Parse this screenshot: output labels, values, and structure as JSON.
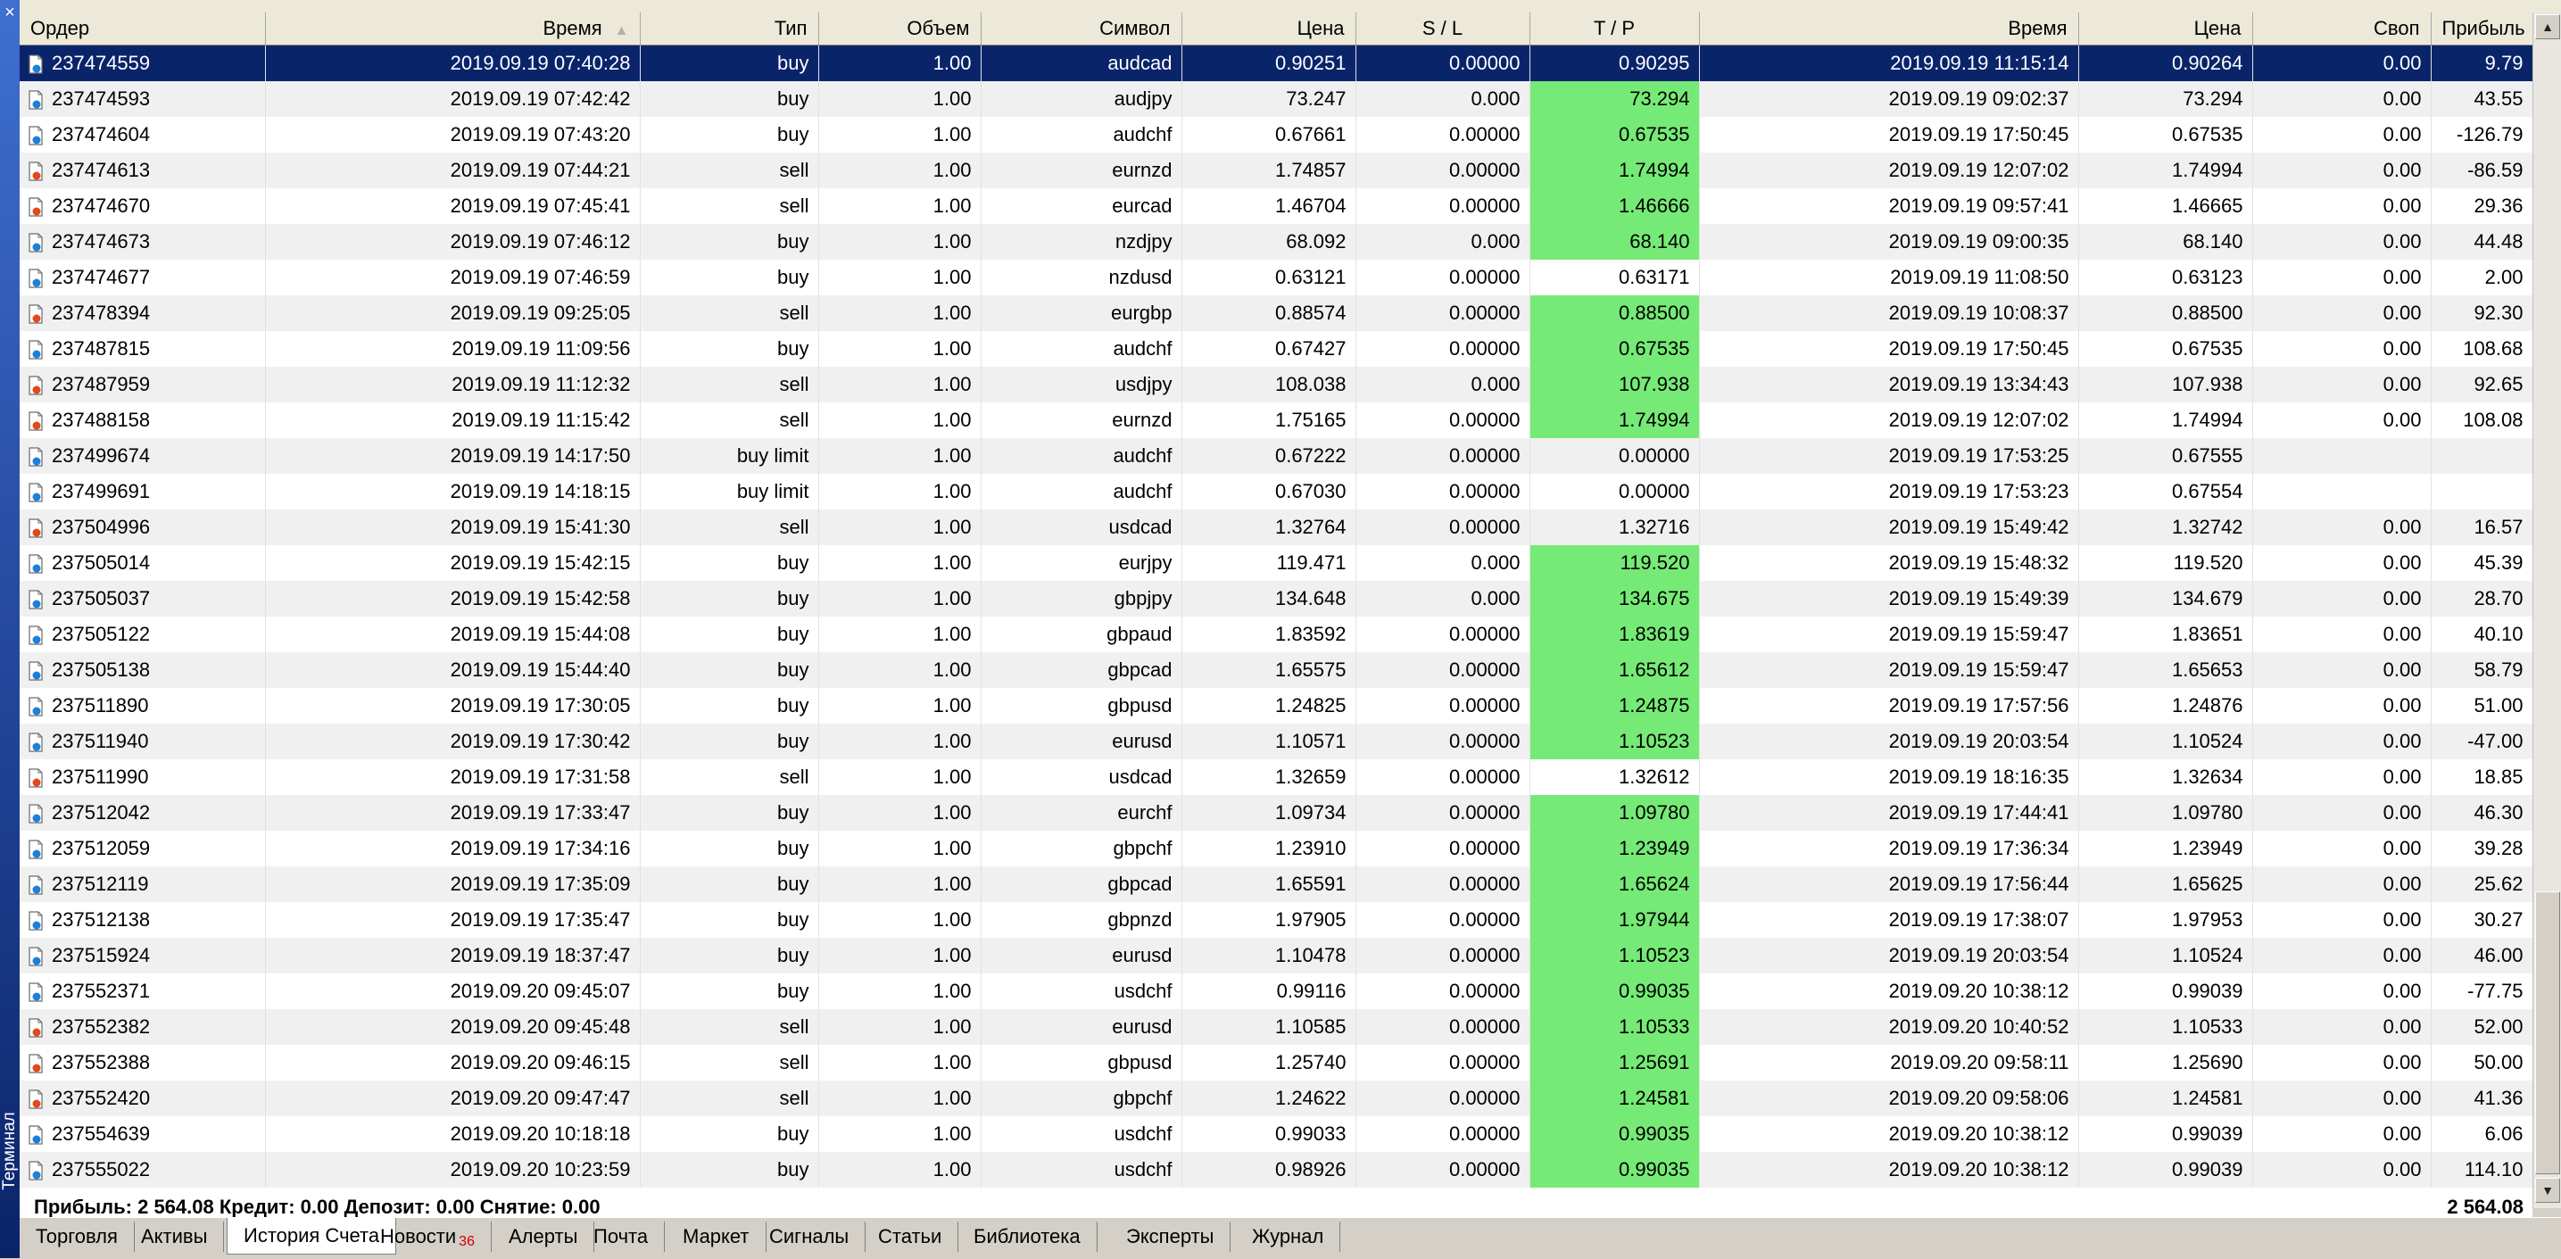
{
  "window": {
    "side_title": "Терминал",
    "close_label": "×"
  },
  "columns": [
    "Ордер",
    "Время",
    "Тип",
    "Объем",
    "Символ",
    "Цена",
    "S / L",
    "T / P",
    "Время",
    "Цена",
    "Своп",
    "Прибыль"
  ],
  "sort_indicator": "▲",
  "rows": [
    {
      "order": "237474559",
      "open_time": "2019.09.19 07:40:28",
      "type": "buy",
      "volume": "1.00",
      "symbol": "audcad",
      "price": "0.90251",
      "sl": "0.00000",
      "tp": "0.90295",
      "close_time": "2019.09.19 11:15:14",
      "close_price": "0.90264",
      "swap": "0.00",
      "profit": "9.79",
      "tp_hit": false,
      "selected": true,
      "icon": "buy-order-icon"
    },
    {
      "order": "237474593",
      "open_time": "2019.09.19 07:42:42",
      "type": "buy",
      "volume": "1.00",
      "symbol": "audjpy",
      "price": "73.247",
      "sl": "0.000",
      "tp": "73.294",
      "close_time": "2019.09.19 09:02:37",
      "close_price": "73.294",
      "swap": "0.00",
      "profit": "43.55",
      "tp_hit": true,
      "selected": false,
      "icon": "buy-order-icon"
    },
    {
      "order": "237474604",
      "open_time": "2019.09.19 07:43:20",
      "type": "buy",
      "volume": "1.00",
      "symbol": "audchf",
      "price": "0.67661",
      "sl": "0.00000",
      "tp": "0.67535",
      "close_time": "2019.09.19 17:50:45",
      "close_price": "0.67535",
      "swap": "0.00",
      "profit": "-126.79",
      "tp_hit": true,
      "selected": false,
      "icon": "buy-order-icon"
    },
    {
      "order": "237474613",
      "open_time": "2019.09.19 07:44:21",
      "type": "sell",
      "volume": "1.00",
      "symbol": "eurnzd",
      "price": "1.74857",
      "sl": "0.00000",
      "tp": "1.74994",
      "close_time": "2019.09.19 12:07:02",
      "close_price": "1.74994",
      "swap": "0.00",
      "profit": "-86.59",
      "tp_hit": true,
      "selected": false,
      "icon": "sell-order-icon"
    },
    {
      "order": "237474670",
      "open_time": "2019.09.19 07:45:41",
      "type": "sell",
      "volume": "1.00",
      "symbol": "eurcad",
      "price": "1.46704",
      "sl": "0.00000",
      "tp": "1.46666",
      "close_time": "2019.09.19 09:57:41",
      "close_price": "1.46665",
      "swap": "0.00",
      "profit": "29.36",
      "tp_hit": true,
      "selected": false,
      "icon": "sell-order-icon"
    },
    {
      "order": "237474673",
      "open_time": "2019.09.19 07:46:12",
      "type": "buy",
      "volume": "1.00",
      "symbol": "nzdjpy",
      "price": "68.092",
      "sl": "0.000",
      "tp": "68.140",
      "close_time": "2019.09.19 09:00:35",
      "close_price": "68.140",
      "swap": "0.00",
      "profit": "44.48",
      "tp_hit": true,
      "selected": false,
      "icon": "buy-order-icon"
    },
    {
      "order": "237474677",
      "open_time": "2019.09.19 07:46:59",
      "type": "buy",
      "volume": "1.00",
      "symbol": "nzdusd",
      "price": "0.63121",
      "sl": "0.00000",
      "tp": "0.63171",
      "close_time": "2019.09.19 11:08:50",
      "close_price": "0.63123",
      "swap": "0.00",
      "profit": "2.00",
      "tp_hit": false,
      "selected": false,
      "icon": "buy-order-icon"
    },
    {
      "order": "237478394",
      "open_time": "2019.09.19 09:25:05",
      "type": "sell",
      "volume": "1.00",
      "symbol": "eurgbp",
      "price": "0.88574",
      "sl": "0.00000",
      "tp": "0.88500",
      "close_time": "2019.09.19 10:08:37",
      "close_price": "0.88500",
      "swap": "0.00",
      "profit": "92.30",
      "tp_hit": true,
      "selected": false,
      "icon": "sell-order-icon"
    },
    {
      "order": "237487815",
      "open_time": "2019.09.19 11:09:56",
      "type": "buy",
      "volume": "1.00",
      "symbol": "audchf",
      "price": "0.67427",
      "sl": "0.00000",
      "tp": "0.67535",
      "close_time": "2019.09.19 17:50:45",
      "close_price": "0.67535",
      "swap": "0.00",
      "profit": "108.68",
      "tp_hit": true,
      "selected": false,
      "icon": "buy-order-icon"
    },
    {
      "order": "237487959",
      "open_time": "2019.09.19 11:12:32",
      "type": "sell",
      "volume": "1.00",
      "symbol": "usdjpy",
      "price": "108.038",
      "sl": "0.000",
      "tp": "107.938",
      "close_time": "2019.09.19 13:34:43",
      "close_price": "107.938",
      "swap": "0.00",
      "profit": "92.65",
      "tp_hit": true,
      "selected": false,
      "icon": "sell-order-icon"
    },
    {
      "order": "237488158",
      "open_time": "2019.09.19 11:15:42",
      "type": "sell",
      "volume": "1.00",
      "symbol": "eurnzd",
      "price": "1.75165",
      "sl": "0.00000",
      "tp": "1.74994",
      "close_time": "2019.09.19 12:07:02",
      "close_price": "1.74994",
      "swap": "0.00",
      "profit": "108.08",
      "tp_hit": true,
      "selected": false,
      "icon": "sell-order-icon"
    },
    {
      "order": "237499674",
      "open_time": "2019.09.19 14:17:50",
      "type": "buy limit",
      "volume": "1.00",
      "symbol": "audchf",
      "price": "0.67222",
      "sl": "0.00000",
      "tp": "0.00000",
      "close_time": "2019.09.19 17:53:25",
      "close_price": "0.67555",
      "swap": "",
      "profit": "",
      "tp_hit": false,
      "selected": false,
      "icon": "buy-order-icon"
    },
    {
      "order": "237499691",
      "open_time": "2019.09.19 14:18:15",
      "type": "buy limit",
      "volume": "1.00",
      "symbol": "audchf",
      "price": "0.67030",
      "sl": "0.00000",
      "tp": "0.00000",
      "close_time": "2019.09.19 17:53:23",
      "close_price": "0.67554",
      "swap": "",
      "profit": "",
      "tp_hit": false,
      "selected": false,
      "icon": "buy-order-icon"
    },
    {
      "order": "237504996",
      "open_time": "2019.09.19 15:41:30",
      "type": "sell",
      "volume": "1.00",
      "symbol": "usdcad",
      "price": "1.32764",
      "sl": "0.00000",
      "tp": "1.32716",
      "close_time": "2019.09.19 15:49:42",
      "close_price": "1.32742",
      "swap": "0.00",
      "profit": "16.57",
      "tp_hit": false,
      "selected": false,
      "icon": "sell-order-icon"
    },
    {
      "order": "237505014",
      "open_time": "2019.09.19 15:42:15",
      "type": "buy",
      "volume": "1.00",
      "symbol": "eurjpy",
      "price": "119.471",
      "sl": "0.000",
      "tp": "119.520",
      "close_time": "2019.09.19 15:48:32",
      "close_price": "119.520",
      "swap": "0.00",
      "profit": "45.39",
      "tp_hit": true,
      "selected": false,
      "icon": "buy-order-icon"
    },
    {
      "order": "237505037",
      "open_time": "2019.09.19 15:42:58",
      "type": "buy",
      "volume": "1.00",
      "symbol": "gbpjpy",
      "price": "134.648",
      "sl": "0.000",
      "tp": "134.675",
      "close_time": "2019.09.19 15:49:39",
      "close_price": "134.679",
      "swap": "0.00",
      "profit": "28.70",
      "tp_hit": true,
      "selected": false,
      "icon": "buy-order-icon"
    },
    {
      "order": "237505122",
      "open_time": "2019.09.19 15:44:08",
      "type": "buy",
      "volume": "1.00",
      "symbol": "gbpaud",
      "price": "1.83592",
      "sl": "0.00000",
      "tp": "1.83619",
      "close_time": "2019.09.19 15:59:47",
      "close_price": "1.83651",
      "swap": "0.00",
      "profit": "40.10",
      "tp_hit": true,
      "selected": false,
      "icon": "buy-order-icon"
    },
    {
      "order": "237505138",
      "open_time": "2019.09.19 15:44:40",
      "type": "buy",
      "volume": "1.00",
      "symbol": "gbpcad",
      "price": "1.65575",
      "sl": "0.00000",
      "tp": "1.65612",
      "close_time": "2019.09.19 15:59:47",
      "close_price": "1.65653",
      "swap": "0.00",
      "profit": "58.79",
      "tp_hit": true,
      "selected": false,
      "icon": "buy-order-icon"
    },
    {
      "order": "237511890",
      "open_time": "2019.09.19 17:30:05",
      "type": "buy",
      "volume": "1.00",
      "symbol": "gbpusd",
      "price": "1.24825",
      "sl": "0.00000",
      "tp": "1.24875",
      "close_time": "2019.09.19 17:57:56",
      "close_price": "1.24876",
      "swap": "0.00",
      "profit": "51.00",
      "tp_hit": true,
      "selected": false,
      "icon": "buy-order-icon"
    },
    {
      "order": "237511940",
      "open_time": "2019.09.19 17:30:42",
      "type": "buy",
      "volume": "1.00",
      "symbol": "eurusd",
      "price": "1.10571",
      "sl": "0.00000",
      "tp": "1.10523",
      "close_time": "2019.09.19 20:03:54",
      "close_price": "1.10524",
      "swap": "0.00",
      "profit": "-47.00",
      "tp_hit": true,
      "selected": false,
      "icon": "buy-order-icon"
    },
    {
      "order": "237511990",
      "open_time": "2019.09.19 17:31:58",
      "type": "sell",
      "volume": "1.00",
      "symbol": "usdcad",
      "price": "1.32659",
      "sl": "0.00000",
      "tp": "1.32612",
      "close_time": "2019.09.19 18:16:35",
      "close_price": "1.32634",
      "swap": "0.00",
      "profit": "18.85",
      "tp_hit": false,
      "selected": false,
      "icon": "sell-order-icon"
    },
    {
      "order": "237512042",
      "open_time": "2019.09.19 17:33:47",
      "type": "buy",
      "volume": "1.00",
      "symbol": "eurchf",
      "price": "1.09734",
      "sl": "0.00000",
      "tp": "1.09780",
      "close_time": "2019.09.19 17:44:41",
      "close_price": "1.09780",
      "swap": "0.00",
      "profit": "46.30",
      "tp_hit": true,
      "selected": false,
      "icon": "buy-order-icon"
    },
    {
      "order": "237512059",
      "open_time": "2019.09.19 17:34:16",
      "type": "buy",
      "volume": "1.00",
      "symbol": "gbpchf",
      "price": "1.23910",
      "sl": "0.00000",
      "tp": "1.23949",
      "close_time": "2019.09.19 17:36:34",
      "close_price": "1.23949",
      "swap": "0.00",
      "profit": "39.28",
      "tp_hit": true,
      "selected": false,
      "icon": "buy-order-icon"
    },
    {
      "order": "237512119",
      "open_time": "2019.09.19 17:35:09",
      "type": "buy",
      "volume": "1.00",
      "symbol": "gbpcad",
      "price": "1.65591",
      "sl": "0.00000",
      "tp": "1.65624",
      "close_time": "2019.09.19 17:56:44",
      "close_price": "1.65625",
      "swap": "0.00",
      "profit": "25.62",
      "tp_hit": true,
      "selected": false,
      "icon": "buy-order-icon"
    },
    {
      "order": "237512138",
      "open_time": "2019.09.19 17:35:47",
      "type": "buy",
      "volume": "1.00",
      "symbol": "gbpnzd",
      "price": "1.97905",
      "sl": "0.00000",
      "tp": "1.97944",
      "close_time": "2019.09.19 17:38:07",
      "close_price": "1.97953",
      "swap": "0.00",
      "profit": "30.27",
      "tp_hit": true,
      "selected": false,
      "icon": "buy-order-icon"
    },
    {
      "order": "237515924",
      "open_time": "2019.09.19 18:37:47",
      "type": "buy",
      "volume": "1.00",
      "symbol": "eurusd",
      "price": "1.10478",
      "sl": "0.00000",
      "tp": "1.10523",
      "close_time": "2019.09.19 20:03:54",
      "close_price": "1.10524",
      "swap": "0.00",
      "profit": "46.00",
      "tp_hit": true,
      "selected": false,
      "icon": "buy-order-icon"
    },
    {
      "order": "237552371",
      "open_time": "2019.09.20 09:45:07",
      "type": "buy",
      "volume": "1.00",
      "symbol": "usdchf",
      "price": "0.99116",
      "sl": "0.00000",
      "tp": "0.99035",
      "close_time": "2019.09.20 10:38:12",
      "close_price": "0.99039",
      "swap": "0.00",
      "profit": "-77.75",
      "tp_hit": true,
      "selected": false,
      "icon": "buy-order-icon"
    },
    {
      "order": "237552382",
      "open_time": "2019.09.20 09:45:48",
      "type": "sell",
      "volume": "1.00",
      "symbol": "eurusd",
      "price": "1.10585",
      "sl": "0.00000",
      "tp": "1.10533",
      "close_time": "2019.09.20 10:40:52",
      "close_price": "1.10533",
      "swap": "0.00",
      "profit": "52.00",
      "tp_hit": true,
      "selected": false,
      "icon": "sell-order-icon"
    },
    {
      "order": "237552388",
      "open_time": "2019.09.20 09:46:15",
      "type": "sell",
      "volume": "1.00",
      "symbol": "gbpusd",
      "price": "1.25740",
      "sl": "0.00000",
      "tp": "1.25691",
      "close_time": "2019.09.20 09:58:11",
      "close_price": "1.25690",
      "swap": "0.00",
      "profit": "50.00",
      "tp_hit": true,
      "selected": false,
      "icon": "sell-order-icon"
    },
    {
      "order": "237552420",
      "open_time": "2019.09.20 09:47:47",
      "type": "sell",
      "volume": "1.00",
      "symbol": "gbpchf",
      "price": "1.24622",
      "sl": "0.00000",
      "tp": "1.24581",
      "close_time": "2019.09.20 09:58:06",
      "close_price": "1.24581",
      "swap": "0.00",
      "profit": "41.36",
      "tp_hit": true,
      "selected": false,
      "icon": "sell-order-icon"
    },
    {
      "order": "237554639",
      "open_time": "2019.09.20 10:18:18",
      "type": "buy",
      "volume": "1.00",
      "symbol": "usdchf",
      "price": "0.99033",
      "sl": "0.00000",
      "tp": "0.99035",
      "close_time": "2019.09.20 10:38:12",
      "close_price": "0.99039",
      "swap": "0.00",
      "profit": "6.06",
      "tp_hit": true,
      "selected": false,
      "icon": "buy-order-icon"
    },
    {
      "order": "237555022",
      "open_time": "2019.09.20 10:23:59",
      "type": "buy",
      "volume": "1.00",
      "symbol": "usdchf",
      "price": "0.98926",
      "sl": "0.00000",
      "tp": "0.99035",
      "close_time": "2019.09.20 10:38:12",
      "close_price": "0.99039",
      "swap": "0.00",
      "profit": "114.10",
      "tp_hit": true,
      "selected": false,
      "icon": "buy-order-icon"
    }
  ],
  "summary": {
    "text": "Прибыль: 2 564.08  Кредит: 0.00  Депозит: 0.00  Снятие: 0.00",
    "total": "2 564.08"
  },
  "tabs": [
    {
      "label": "Торговля",
      "active": false,
      "badge": ""
    },
    {
      "label": "Активы",
      "active": false,
      "badge": ""
    },
    {
      "label": "История Счета",
      "active": true,
      "badge": ""
    },
    {
      "label": "Новости",
      "active": false,
      "badge": "36"
    },
    {
      "label": "Алерты",
      "active": false,
      "badge": ""
    },
    {
      "label": "Почта",
      "active": false,
      "badge": ""
    },
    {
      "label": "Маркет",
      "active": false,
      "badge": ""
    },
    {
      "label": "Сигналы",
      "active": false,
      "badge": ""
    },
    {
      "label": "Статьи",
      "active": false,
      "badge": ""
    },
    {
      "label": "Библиотека",
      "active": false,
      "badge": ""
    },
    {
      "label": "Эксперты",
      "active": false,
      "badge": ""
    },
    {
      "label": "Журнал",
      "active": false,
      "badge": ""
    }
  ],
  "colors": {
    "selection": "#0a246a",
    "tp_highlight": "#76ea76",
    "buy_marker": "#1e7fd8",
    "sell_marker": "#e0491f",
    "badge": "#d00000"
  }
}
